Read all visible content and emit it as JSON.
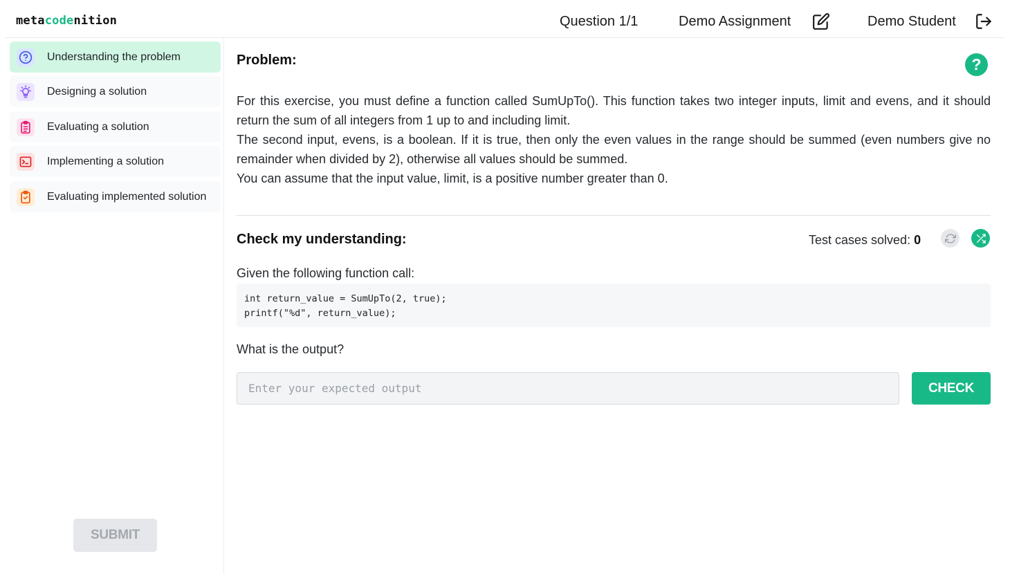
{
  "header": {
    "logo_prefix": "meta",
    "logo_accent": "code",
    "logo_suffix": "nition",
    "question_counter": "Question 1/1",
    "assignment": "Demo Assignment",
    "student": "Demo Student"
  },
  "sidebar": {
    "steps": [
      {
        "label": "Understanding the problem",
        "icon": "question-circle-icon",
        "color": "#3b5bdb",
        "active": true
      },
      {
        "label": "Designing a solution",
        "icon": "lightbulb-icon",
        "color": "#8b5cf6",
        "active": false
      },
      {
        "label": "Evaluating a solution",
        "icon": "clipboard-list-icon",
        "color": "#e11d74",
        "active": false
      },
      {
        "label": "Implementing a solution",
        "icon": "terminal-icon",
        "color": "#dc2626",
        "active": false
      },
      {
        "label": "Evaluating implemented solution",
        "icon": "clipboard-check-icon",
        "color": "#ea580c",
        "active": false
      }
    ],
    "submit_label": "SUBMIT"
  },
  "problem": {
    "title": "Problem:",
    "help_symbol": "?",
    "paragraphs": [
      "For this exercise, you must define a function called SumUpTo(). This function takes two integer inputs, limit and evens, and it should return the sum of all integers from 1 up to and including limit.",
      "The second input, evens, is a boolean. If it is true, then only the even values in the range should be summed (even numbers give no remainder when divided by 2), otherwise all values should be summed.",
      "You can assume that the input value, limit, is a positive number greater than 0."
    ]
  },
  "check": {
    "title": "Check my understanding:",
    "tests_solved_label": "Test cases solved:",
    "tests_solved_count": "0",
    "given_label": "Given the following function call:",
    "code": "int return_value = SumUpTo(2, true);\nprintf(\"%d\", return_value);",
    "question": "What is the output?",
    "input_placeholder": "Enter your expected output",
    "input_value": "",
    "check_label": "CHECK"
  },
  "colors": {
    "accent": "#19b987",
    "active_step_bg": "#d1f7e4"
  }
}
